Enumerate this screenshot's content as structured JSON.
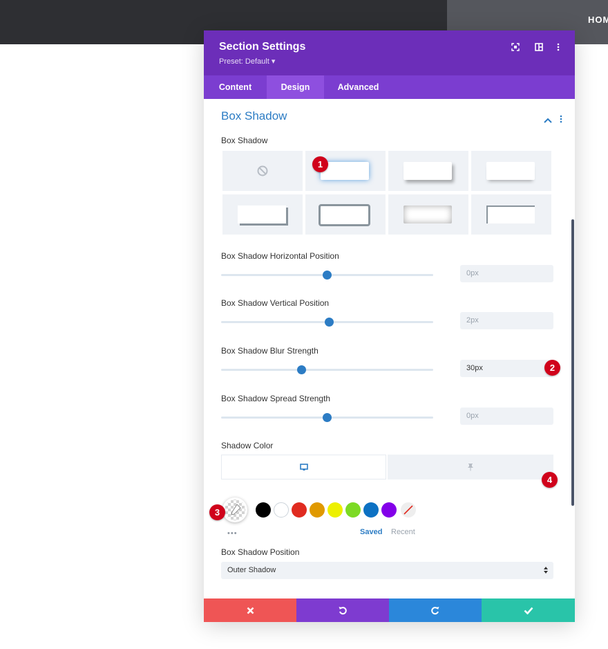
{
  "background": {
    "nav_home": "HOM"
  },
  "modal": {
    "title": "Section Settings",
    "preset": "Preset: Default ▾",
    "tabs": [
      {
        "label": "Content",
        "active": false
      },
      {
        "label": "Design",
        "active": true
      },
      {
        "label": "Advanced",
        "active": false
      }
    ]
  },
  "section": {
    "title": "Box Shadow",
    "box_shadow_label": "Box Shadow",
    "h_pos": {
      "label": "Box Shadow Horizontal Position",
      "value": "0px",
      "level": 0.5
    },
    "v_pos": {
      "label": "Box Shadow Vertical Position",
      "value": "2px",
      "level": 0.51
    },
    "blur": {
      "label": "Box Shadow Blur Strength",
      "value": "30px",
      "level": 0.38
    },
    "spread": {
      "label": "Box Shadow Spread Strength",
      "value": "0px",
      "level": 0.5
    },
    "shadow_color_label": "Shadow Color",
    "swatches": [
      "#000000",
      "#ffffff",
      "#e02b20",
      "#e09900",
      "#edf000",
      "#7cda24",
      "#0c71c3",
      "#8300e9"
    ],
    "saved_label": "Saved",
    "recent_label": "Recent",
    "more_dots": "•••",
    "position_label": "Box Shadow Position",
    "position_value": "Outer Shadow"
  },
  "markers": [
    "1",
    "2",
    "3",
    "4"
  ],
  "colors": {
    "header": "#6c2eb9",
    "tabs": "#7b3dd0",
    "accent": "#2c7cc4",
    "cancel": "#ef5555",
    "undo": "#7e3bd0",
    "redo": "#2b87da",
    "save": "#29c4a9"
  }
}
